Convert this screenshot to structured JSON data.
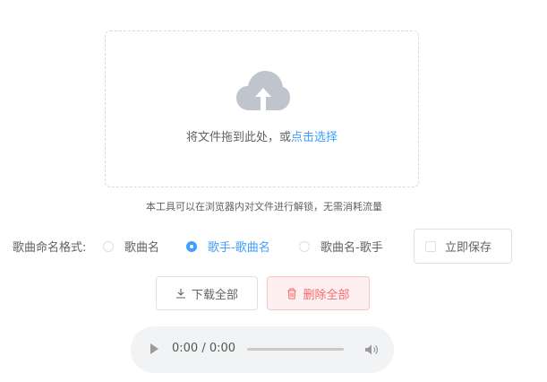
{
  "upload": {
    "text": "将文件拖到此处，或",
    "link": "点击选择",
    "icon": "cloud-upload-icon"
  },
  "tip": "本工具可以在浏览器内对文件进行解锁，无需消耗流量",
  "format": {
    "label": "歌曲命名格式:",
    "options": [
      {
        "label": "歌曲名",
        "checked": false
      },
      {
        "label": "歌手-歌曲名",
        "checked": true
      },
      {
        "label": "歌曲名-歌手",
        "checked": false
      }
    ],
    "save_label": "立即保存",
    "save_checked": false
  },
  "buttons": {
    "download": "下载全部",
    "delete": "删除全部"
  },
  "player": {
    "time": "0:00 / 0:00",
    "progress": 0
  },
  "colors": {
    "accent": "#409eff",
    "danger": "#f56c6c",
    "danger_bg": "#fef0f0"
  }
}
